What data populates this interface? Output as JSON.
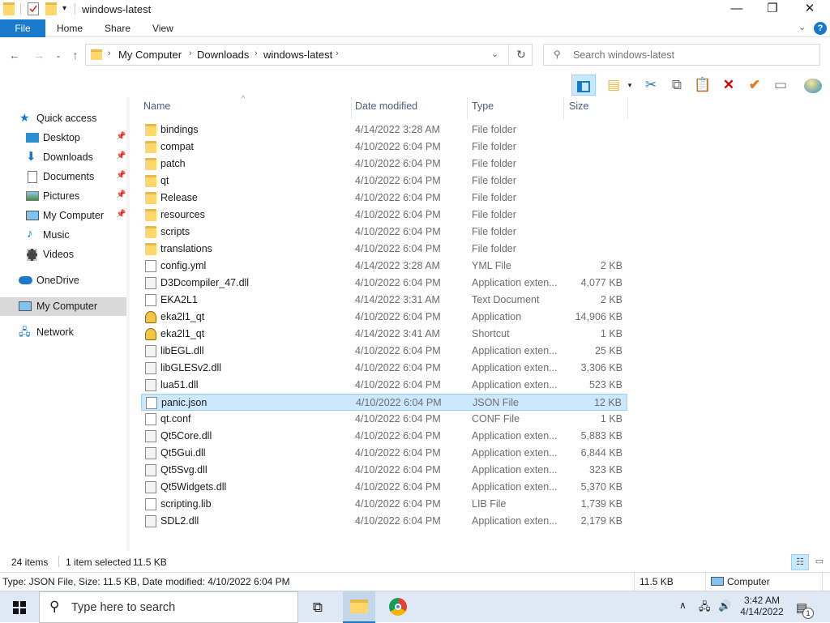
{
  "window": {
    "title": "windows-latest",
    "minimize_icon": "minimize-icon",
    "maximize_icon": "maximize-icon",
    "close_icon": "close-icon"
  },
  "ribbon": {
    "tabs": [
      "File",
      "Home",
      "Share",
      "View"
    ]
  },
  "address": {
    "crumbs": [
      "My Computer",
      "Downloads",
      "windows-latest"
    ]
  },
  "search": {
    "placeholder": "Search windows-latest"
  },
  "sidebar": {
    "items": [
      {
        "label": "Quick access",
        "pinned": false
      },
      {
        "label": "Desktop",
        "pinned": true
      },
      {
        "label": "Downloads",
        "pinned": true
      },
      {
        "label": "Documents",
        "pinned": true
      },
      {
        "label": "Pictures",
        "pinned": true
      },
      {
        "label": "My Computer",
        "pinned": true
      },
      {
        "label": "Music",
        "pinned": false
      },
      {
        "label": "Videos",
        "pinned": false
      },
      {
        "label": "OneDrive",
        "pinned": false
      },
      {
        "label": "My Computer",
        "pinned": false
      },
      {
        "label": "Network",
        "pinned": false
      }
    ]
  },
  "columns": {
    "name": "Name",
    "date": "Date modified",
    "type": "Type",
    "size": "Size"
  },
  "files": [
    {
      "name": "bindings",
      "date": "4/14/2022 3:28 AM",
      "type": "File folder",
      "size": "",
      "icon": "folder"
    },
    {
      "name": "compat",
      "date": "4/10/2022 6:04 PM",
      "type": "File folder",
      "size": "",
      "icon": "folder"
    },
    {
      "name": "patch",
      "date": "4/10/2022 6:04 PM",
      "type": "File folder",
      "size": "",
      "icon": "folder"
    },
    {
      "name": "qt",
      "date": "4/10/2022 6:04 PM",
      "type": "File folder",
      "size": "",
      "icon": "folder"
    },
    {
      "name": "Release",
      "date": "4/10/2022 6:04 PM",
      "type": "File folder",
      "size": "",
      "icon": "folder"
    },
    {
      "name": "resources",
      "date": "4/10/2022 6:04 PM",
      "type": "File folder",
      "size": "",
      "icon": "folder"
    },
    {
      "name": "scripts",
      "date": "4/10/2022 6:04 PM",
      "type": "File folder",
      "size": "",
      "icon": "folder"
    },
    {
      "name": "translations",
      "date": "4/10/2022 6:04 PM",
      "type": "File folder",
      "size": "",
      "icon": "folder"
    },
    {
      "name": "config.yml",
      "date": "4/14/2022 3:28 AM",
      "type": "YML File",
      "size": "2 KB",
      "icon": "document"
    },
    {
      "name": "D3Dcompiler_47.dll",
      "date": "4/10/2022 6:04 PM",
      "type": "Application exten...",
      "size": "4,077 KB",
      "icon": "dll"
    },
    {
      "name": "EKA2L1",
      "date": "4/14/2022 3:31 AM",
      "type": "Text Document",
      "size": "2 KB",
      "icon": "document"
    },
    {
      "name": "eka2l1_qt",
      "date": "4/10/2022 6:04 PM",
      "type": "Application",
      "size": "14,906 KB",
      "icon": "application"
    },
    {
      "name": "eka2l1_qt",
      "date": "4/14/2022 3:41 AM",
      "type": "Shortcut",
      "size": "1 KB",
      "icon": "application"
    },
    {
      "name": "libEGL.dll",
      "date": "4/10/2022 6:04 PM",
      "type": "Application exten...",
      "size": "25 KB",
      "icon": "dll"
    },
    {
      "name": "libGLESv2.dll",
      "date": "4/10/2022 6:04 PM",
      "type": "Application exten...",
      "size": "3,306 KB",
      "icon": "dll"
    },
    {
      "name": "lua51.dll",
      "date": "4/10/2022 6:04 PM",
      "type": "Application exten...",
      "size": "523 KB",
      "icon": "dll"
    },
    {
      "name": "panic.json",
      "date": "4/10/2022 6:04 PM",
      "type": "JSON File",
      "size": "12 KB",
      "icon": "document",
      "selected": true
    },
    {
      "name": "qt.conf",
      "date": "4/10/2022 6:04 PM",
      "type": "CONF File",
      "size": "1 KB",
      "icon": "document"
    },
    {
      "name": "Qt5Core.dll",
      "date": "4/10/2022 6:04 PM",
      "type": "Application exten...",
      "size": "5,883 KB",
      "icon": "dll"
    },
    {
      "name": "Qt5Gui.dll",
      "date": "4/10/2022 6:04 PM",
      "type": "Application exten...",
      "size": "6,844 KB",
      "icon": "dll"
    },
    {
      "name": "Qt5Svg.dll",
      "date": "4/10/2022 6:04 PM",
      "type": "Application exten...",
      "size": "323 KB",
      "icon": "dll"
    },
    {
      "name": "Qt5Widgets.dll",
      "date": "4/10/2022 6:04 PM",
      "type": "Application exten...",
      "size": "5,370 KB",
      "icon": "dll"
    },
    {
      "name": "scripting.lib",
      "date": "4/10/2022 6:04 PM",
      "type": "LIB File",
      "size": "1,739 KB",
      "icon": "document"
    },
    {
      "name": "SDL2.dll",
      "date": "4/10/2022 6:04 PM",
      "type": "Application exten...",
      "size": "2,179 KB",
      "icon": "dll"
    }
  ],
  "status": {
    "count": "24 items",
    "selected": "1 item selected",
    "selected_size": "11.5 KB",
    "details": "Type: JSON File, Size: 11.5 KB, Date modified: 4/10/2022 6:04 PM",
    "size": "11.5 KB",
    "location": "Computer"
  },
  "taskbar": {
    "search_placeholder": "Type here to search",
    "time": "3:42 AM",
    "date": "4/14/2022",
    "notification_count": "1"
  },
  "colors": {
    "accent": "#1979ca",
    "selection": "#cce8ff",
    "selection_border": "#99d1ff",
    "folder": "#ffd76a"
  }
}
